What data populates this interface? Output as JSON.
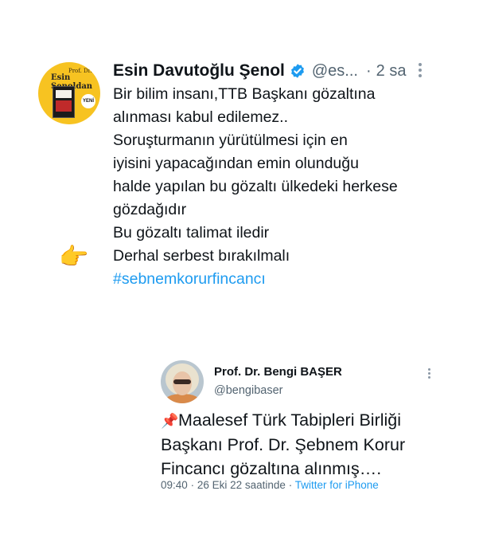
{
  "colors": {
    "link": "#1d9bf0",
    "text": "#0f1419",
    "muted": "#536471",
    "avatar_bg": "#f7c321"
  },
  "main_tweet": {
    "avatar_text": {
      "top": "Prof. Dr.",
      "name": "Esin Şenoldan",
      "badge": "YENİ"
    },
    "author_name": "Esin Davutoğlu Şenol",
    "verified_icon": "verified-badge-icon",
    "handle": "@es...",
    "separator": "·",
    "time": "2 sa",
    "body_lines": [
      "Bir bilim insanı,TTB Başkanı gözaltına",
      "alınması kabul edilemez..",
      "Soruşturmanın  yürütülmesi için  en",
      "iyisini yapacağından emin olunduğu",
      "halde yapılan bu gözaltı ülkedeki herkese",
      "gözdağıdır",
      "Bu gözaltı talimat iledir",
      "Derhal serbest bırakılmalı"
    ],
    "hashtag": "#sebnemkorurfincancı",
    "pointer_emoji": "👉"
  },
  "quoted_tweet": {
    "author_name": "Prof. Dr. Bengi BAŞER",
    "handle": "@bengibaser",
    "pin_emoji": "📌",
    "body_lines": [
      "Maalesef Türk Tabipleri Birliği",
      "Başkanı Prof. Dr. Şebnem Korur",
      "Fincancı gözaltına alınmış…."
    ],
    "time": "09:40",
    "date": "26 Eki 22 saatinde",
    "source": "Twitter for iPhone",
    "meta_sep": "·"
  }
}
